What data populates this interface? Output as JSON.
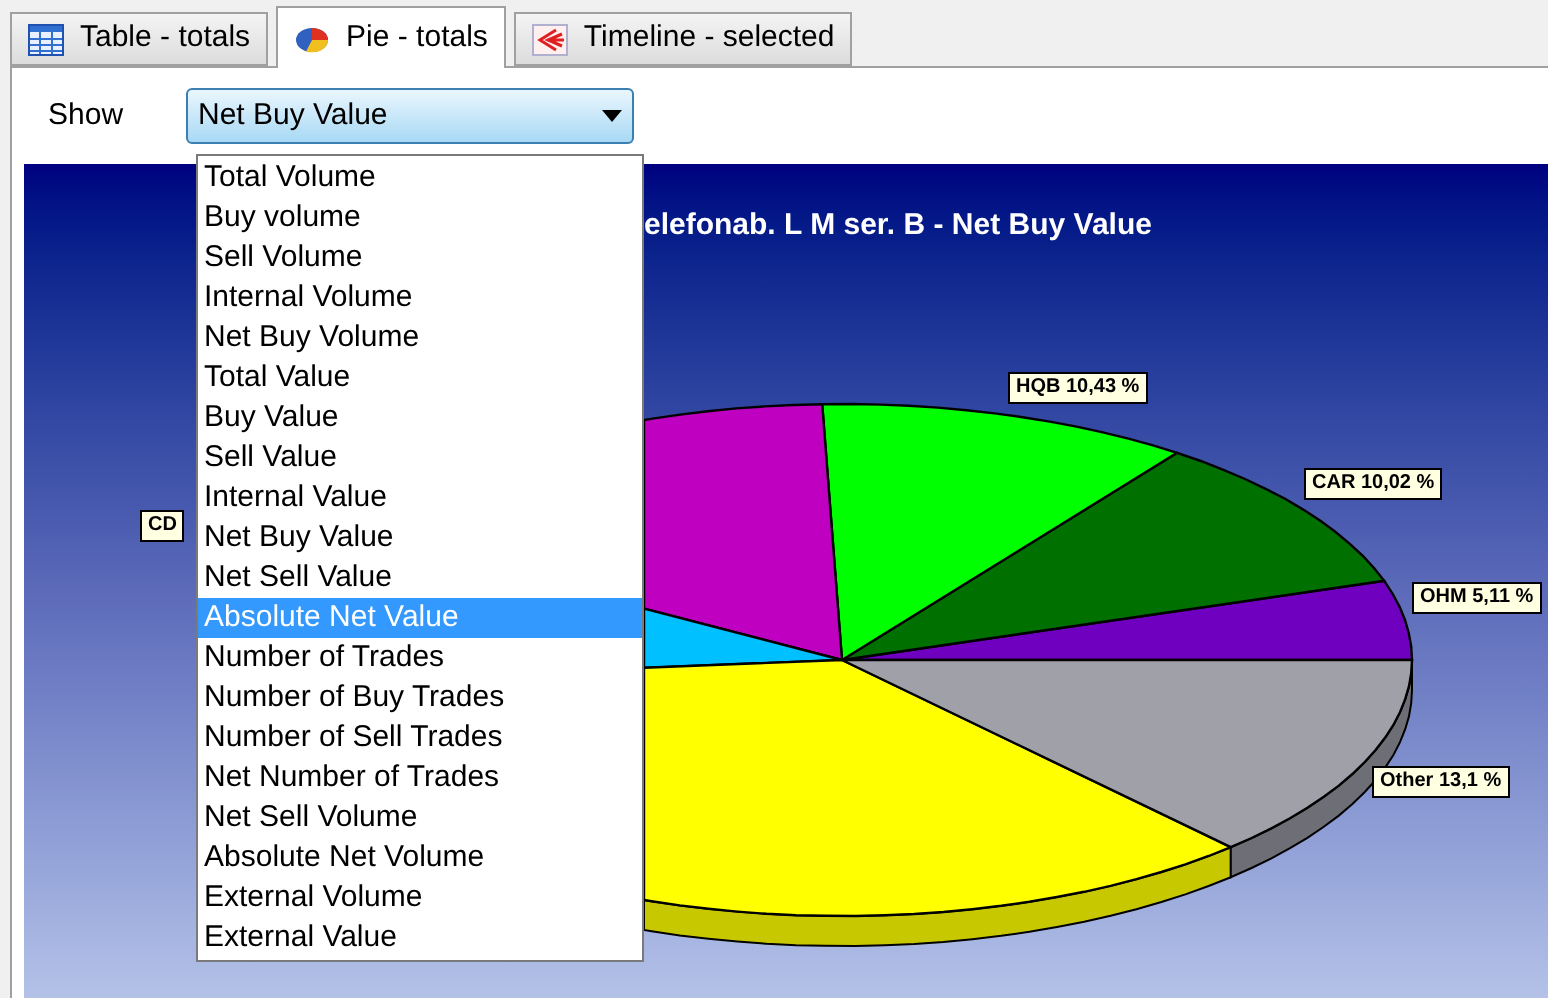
{
  "tabs": [
    {
      "label": "Table - totals",
      "kind": "table",
      "selected": false
    },
    {
      "label": "Pie - totals",
      "kind": "pie",
      "selected": true
    },
    {
      "label": "Timeline - selected",
      "kind": "timeline",
      "selected": false
    }
  ],
  "show": {
    "label": "Show",
    "value": "Net Buy Value"
  },
  "dropdown": [
    {
      "label": "Total Volume",
      "selected": false
    },
    {
      "label": "Buy volume",
      "selected": false
    },
    {
      "label": "Sell Volume",
      "selected": false
    },
    {
      "label": "Internal Volume",
      "selected": false
    },
    {
      "label": "Net Buy Volume",
      "selected": false
    },
    {
      "label": "Total Value",
      "selected": false
    },
    {
      "label": "Buy Value",
      "selected": false
    },
    {
      "label": "Sell Value",
      "selected": false
    },
    {
      "label": "Internal Value",
      "selected": false
    },
    {
      "label": "Net Buy Value",
      "selected": false
    },
    {
      "label": "Net Sell Value",
      "selected": false
    },
    {
      "label": "Absolute Net Value",
      "selected": true
    },
    {
      "label": "Number of Trades",
      "selected": false
    },
    {
      "label": "Number of Buy Trades",
      "selected": false
    },
    {
      "label": "Number of Sell Trades",
      "selected": false
    },
    {
      "label": "Net Number of Trades",
      "selected": false
    },
    {
      "label": "Net Sell Volume",
      "selected": false
    },
    {
      "label": "Absolute Net Volume",
      "selected": false
    },
    {
      "label": "External Volume",
      "selected": false
    },
    {
      "label": "External Value",
      "selected": false
    }
  ],
  "chart": {
    "title": "elefonab. L M ser. B - Net Buy Value",
    "labels": [
      "CD",
      "HQB 10,43 %",
      "CAR 10,02 %",
      "OHM 5,11 %",
      "Other 13,1 %"
    ]
  }
}
